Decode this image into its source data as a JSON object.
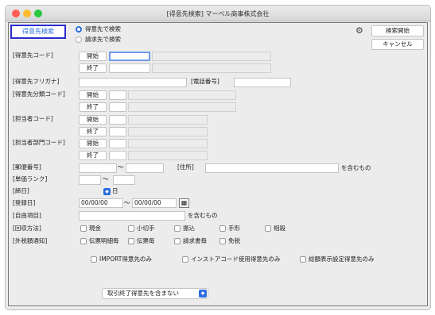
{
  "window": {
    "title": "[得意先検索] マーベル商事株式会社"
  },
  "tab_label": "得意先検索",
  "search_target": {
    "options": [
      "得意先で検索",
      "請求先で検索"
    ],
    "selected": "得意先で検索"
  },
  "actions": {
    "search_start": "検索開始",
    "cancel": "キャンセル"
  },
  "labels": {
    "customer_code": "[得意先コード]",
    "customer_kana": "[得意先フリガナ]",
    "phone": "[電話番号]",
    "customer_class_code": "[得意先分類コード]",
    "staff_code": "[担当者コード]",
    "staff_dept_code": "[担当者部門コード]",
    "postal_code": "[郵便番号]",
    "address": "[住所]",
    "contains": "を含むもの",
    "price_rank": "[単価ランク]",
    "closing_day": "[締日]",
    "day_suffix": "日",
    "registration_date": "[登録日]",
    "free_item": "[自由項目]",
    "collection_method": "[回収方法]",
    "output_notice": "[外税額通知]",
    "start": "開始",
    "end": "終了",
    "tilde": "〜"
  },
  "registration_date": {
    "from": "00/00/00",
    "to": "00/00/00"
  },
  "collection_methods": [
    "現金",
    "小切手",
    "振込",
    "手形",
    "相殺"
  ],
  "output_notices": [
    "伝票明細毎",
    "伝票毎",
    "請求書毎",
    "免税"
  ],
  "filters": [
    "IMPORT得意先のみ",
    "インストアコード使用得意先のみ",
    "総額表示設定得意先のみ"
  ],
  "dropdown": {
    "selected": "取引終了得意先を含まない"
  },
  "colors": {
    "accent": "#2d6de0",
    "tab_border": "#2b2bd0",
    "close": "#ff5f57",
    "minimize": "#febc2e",
    "zoom": "#28c840"
  }
}
